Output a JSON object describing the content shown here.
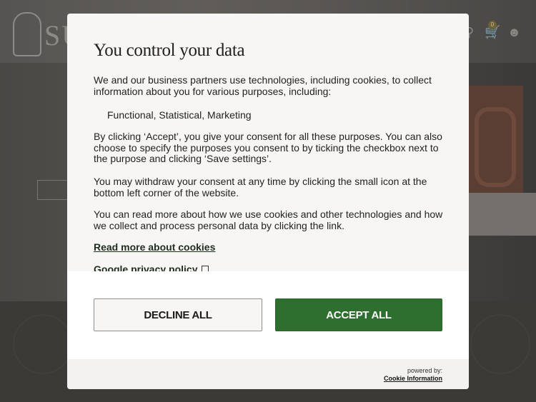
{
  "site": {
    "logo_text": "SU"
  },
  "cart": {
    "count": "0"
  },
  "consent": {
    "title": "You control your data",
    "intro": "We and our business partners use technologies, including cookies, to collect information about you for various purposes, including:",
    "purposes": "Functional, Statistical, Marketing",
    "consent_text": "By clicking ‘Accept’, you give your consent for all these purposes. You can also choose to specify the purposes you consent to by ticking the checkbox next to the purpose and clicking ‘Save settings’.",
    "withdraw_text": "You may withdraw your consent at any time by clicking the small icon at the bottom left corner of the website.",
    "read_more_text": "You can read more about how we use cookies and other technologies and how we collect and process personal data by clicking the link.",
    "links": {
      "cookies": "Read more about cookies",
      "google_privacy": "Google privacy policy"
    },
    "buttons": {
      "decline": "DECLINE ALL",
      "accept": "ACCEPT ALL"
    },
    "footer": {
      "powered_by": "powered by:",
      "provider": "Cookie Information"
    }
  },
  "colors": {
    "accept": "#2e6f2f",
    "modal_bg": "#f7f6f4",
    "overlay": "#3a3936"
  },
  "icons": {
    "external_link": "external-link-icon",
    "cart": "cart-icon",
    "account": "user-icon",
    "search": "search-icon"
  }
}
